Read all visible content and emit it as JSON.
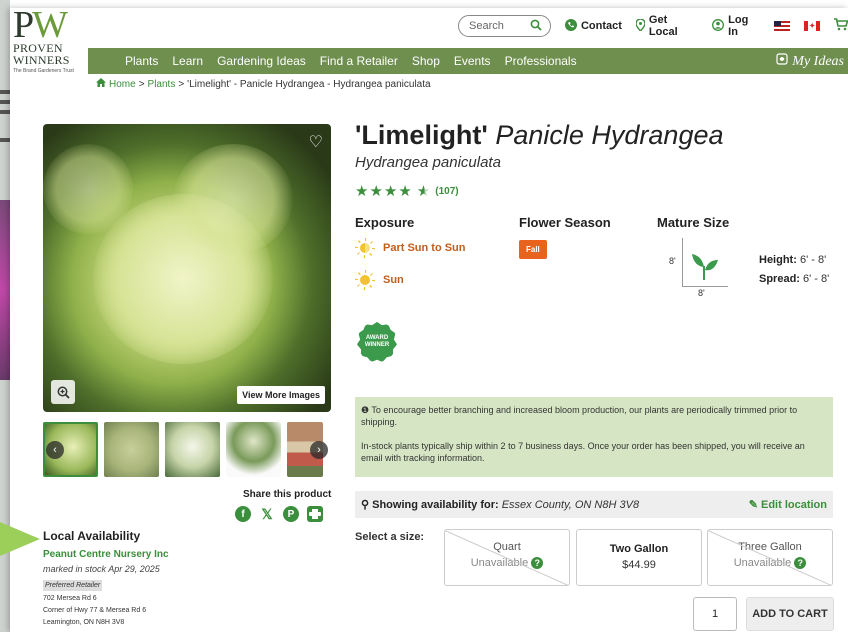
{
  "logo": {
    "mark_p": "P",
    "mark_w": "W",
    "line1": "PROVEN",
    "line2": "WINNERS",
    "tagline": "The Brand Gardeners Trust"
  },
  "utility": {
    "search_placeholder": "Search",
    "contact": "Contact",
    "get_local": "Get Local",
    "log_in": "Log In"
  },
  "nav": {
    "items": [
      "Plants",
      "Learn",
      "Gardening Ideas",
      "Find a Retailer",
      "Shop",
      "Events",
      "Professionals"
    ],
    "my_ideas": "My Ideas"
  },
  "breadcrumb": [
    "Home",
    "Plants",
    "'Limelight' - Panicle Hydrangea - Hydrangea paniculata"
  ],
  "gallery": {
    "view_more": "View More Images",
    "share_label": "Share this product"
  },
  "local": {
    "heading": "Local Availability",
    "store": "Peanut Centre Nursery Inc",
    "marked": "marked in stock Apr 29, 2025",
    "badge": "Preferred Retailer",
    "address": [
      "702 Mersea Rd 6",
      "Corner of Hwy 77 & Mersea Rd 6",
      "Leamington, ON N8H 3V8"
    ]
  },
  "product": {
    "name_bold": "'Limelight'",
    "name_italic": "Panicle Hydrangea",
    "latin": "Hydrangea paniculata",
    "rating": 4.5,
    "review_count": "(107)",
    "exposure_label": "Exposure",
    "exposure": [
      "Part Sun to Sun",
      "Sun"
    ],
    "season_label": "Flower Season",
    "season": "Fall",
    "size_label": "Mature Size",
    "size_h_mark": "8'",
    "size_w_mark": "8'",
    "height_label": "Height:",
    "height_value": "6' - 8'",
    "spread_label": "Spread:",
    "spread_value": "6' - 8'",
    "award": "AWARD WINNER"
  },
  "notice": {
    "line1": "To encourage better branching and increased bloom production, our plants are periodically trimmed prior to shipping.",
    "line2": "In-stock plants typically ship within 2 to 7 business days. Once your order has been shipped, you will receive an email with tracking information."
  },
  "availability": {
    "label": "Showing availability for:",
    "location": "Essex County, ON N8H 3V8",
    "edit": "Edit location"
  },
  "sizes": {
    "label": "Select a size:",
    "options": [
      {
        "name": "Quart",
        "status": "Unavailable"
      },
      {
        "name": "Two Gallon",
        "status": "$44.99"
      },
      {
        "name": "Three Gallon",
        "status": "Unavailable"
      }
    ]
  },
  "cart": {
    "qty": "1",
    "button": "ADD TO CART"
  },
  "colors": {
    "brand_green": "#3b8e3b",
    "nav_green": "#6f8f4f",
    "orange": "#e8641e",
    "notice_bg": "#d6e6c4"
  }
}
